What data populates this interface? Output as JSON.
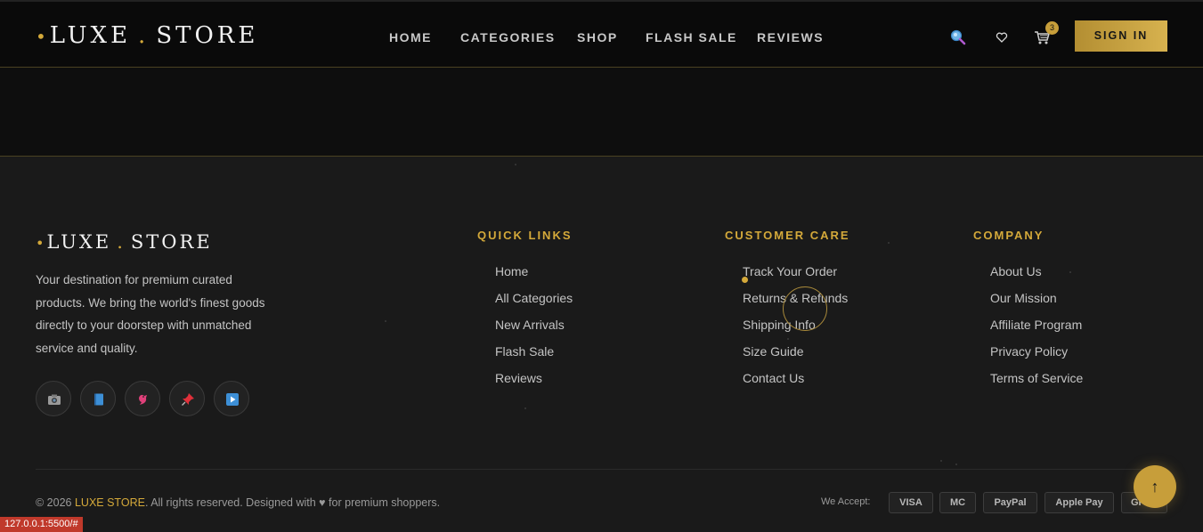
{
  "header": {
    "logo": {
      "left": "LUXE",
      "dot": ".",
      "right": "STORE"
    },
    "nav": [
      {
        "label": "HOME"
      },
      {
        "label": "CATEGORIES"
      },
      {
        "label": "SHOP"
      },
      {
        "label": "FLASH SALE"
      },
      {
        "label": "REVIEWS"
      }
    ],
    "icons": {
      "search": "search-icon",
      "wishlist": "heart-icon",
      "cart": "cart-icon"
    },
    "cart_count": "3",
    "signin_label": "SIGN IN"
  },
  "footer": {
    "logo": {
      "left": "LUXE",
      "dot": ".",
      "right": "STORE"
    },
    "description": "Your destination for premium curated products. We bring the world's finest goods directly to your doorstep with unmatched service and quality.",
    "social": [
      "camera-icon",
      "book-icon",
      "bird-icon",
      "pin-icon",
      "play-icon"
    ],
    "columns": [
      {
        "title": "QUICK LINKS",
        "links": [
          "Home",
          "All Categories",
          "New Arrivals",
          "Flash Sale",
          "Reviews"
        ]
      },
      {
        "title": "CUSTOMER CARE",
        "links": [
          "Track Your Order",
          "Returns & Refunds",
          "Shipping Info",
          "Size Guide",
          "Contact Us"
        ]
      },
      {
        "title": "COMPANY",
        "links": [
          "About Us",
          "Our Mission",
          "Affiliate Program",
          "Privacy Policy",
          "Terms of Service"
        ]
      }
    ],
    "copyright": {
      "prefix": "© 2026 ",
      "brand": "LUXE STORE",
      "suffix": ". All rights reserved. Designed with ♥ for premium shoppers."
    },
    "we_accept_label": "We Accept:",
    "payments": [
      "VISA",
      "MC",
      "PayPal",
      "Apple Pay",
      "GPay"
    ],
    "back_to_top": "↑"
  },
  "status_bar_url": "127.0.0.1:5500/#",
  "colors": {
    "accent": "#d4a93a",
    "background": "#1a1a1a",
    "header_bg": "#0a0a0a"
  }
}
